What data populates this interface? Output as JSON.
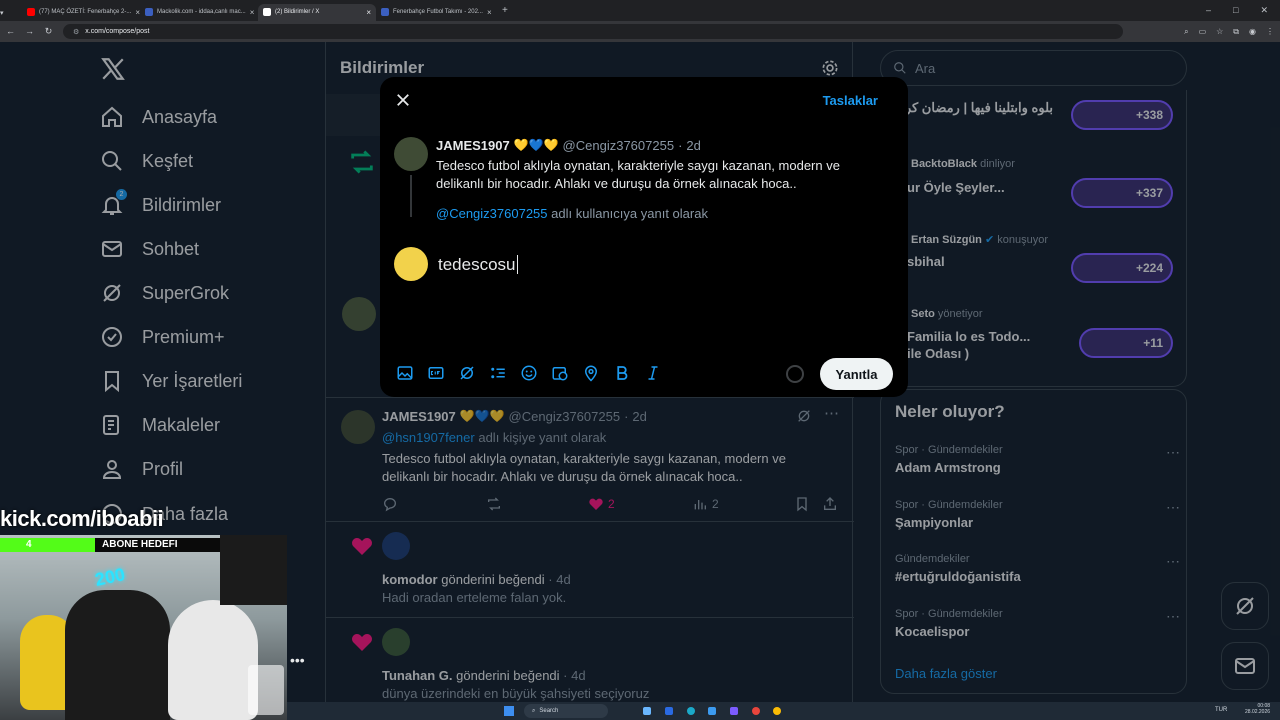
{
  "browser": {
    "tabs": [
      {
        "label": "(77) MAÇ ÖZETİ: Fenerbahçe 2-...",
        "color": "#ff0000"
      },
      {
        "label": "Mackolik.com - iddaa,canlı mac...",
        "color": "#3b5fc0"
      },
      {
        "label": "(2) Bildirimler / X",
        "color": "#ffffff"
      },
      {
        "label": "Fenerbahçe Futbol Takımı - 202...",
        "color": "#3b5fc0"
      }
    ],
    "url": "x.com/compose/post"
  },
  "sidebar": {
    "items": [
      {
        "label": "Anasayfa",
        "icon": "home-icon"
      },
      {
        "label": "Keşfet",
        "icon": "search-icon"
      },
      {
        "label": "Bildirimler",
        "icon": "bell-icon",
        "badge": "2"
      },
      {
        "label": "Sohbet",
        "icon": "mail-icon"
      },
      {
        "label": "SuperGrok",
        "icon": "grok-icon"
      },
      {
        "label": "Premium+",
        "icon": "verified-icon"
      },
      {
        "label": "Yer İşaretleri",
        "icon": "bookmark-icon"
      },
      {
        "label": "Makaleler",
        "icon": "article-icon"
      },
      {
        "label": "Profil",
        "icon": "person-icon"
      },
      {
        "label": "Daha fazla",
        "icon": "more-icon"
      }
    ]
  },
  "main": {
    "title": "Bildirimler",
    "post": {
      "name": "JAMES1907",
      "handle": "@Cengiz37607255",
      "time": "2d",
      "reply_to": "@hsn1907fener",
      "reply_suffix": "adlı kişiye yanıt olarak",
      "text": "Tedesco futbol aklıyla oynatan, karakteriyle saygı kazanan, modern ve delikanlı bir hocadır. Ahlakı ve duruşu da örnek alınacak hoca..",
      "likes": "2",
      "views": "2"
    },
    "likes": [
      {
        "user": "komodor",
        "action": "gönderini beğendi",
        "time": "4d",
        "text": "Hadi oradan erteleme falan yok."
      },
      {
        "user": "Tunahan G.",
        "action": "gönderini beğendi",
        "time": "4d",
        "text": "dünya üzerindeki en büyük şahsiyeti seçiyoruz"
      }
    ]
  },
  "right": {
    "search_placeholder": "Ara",
    "spaces": [
      {
        "host": "",
        "verb": "",
        "title": "بلوه وابتلينا فيها | رمضان كريم",
        "count": "+338"
      },
      {
        "host": "BacktoBlack",
        "verb": "dinliyor",
        "title": "ur Öyle Şeyler...",
        "count": "+337"
      },
      {
        "host": "Ertan Süzgün",
        "verb": "konuşuyor",
        "title": "sbihal",
        "count": "+224"
      },
      {
        "host": "Seto",
        "verb": "yönetiyor",
        "title": "Familia lo es Todo...",
        "title2": "ile Odası )",
        "count": "+11"
      }
    ],
    "trends_title": "Neler oluyor?",
    "trends": [
      {
        "cat": "Spor · Gündemdekiler",
        "name": "Adam Armstrong"
      },
      {
        "cat": "Spor · Gündemdekiler",
        "name": "Şampiyonlar"
      },
      {
        "cat": "Gündemdekiler",
        "name": "#ertuğruldoğanistifa"
      },
      {
        "cat": "Spor · Gündemdekiler",
        "name": "Kocaelispor"
      }
    ],
    "show_more": "Daha fazla göster"
  },
  "modal": {
    "drafts": "Taslaklar",
    "quoted": {
      "name": "JAMES1907",
      "handle": "@Cengiz37607255",
      "time": "2d",
      "text": "Tedesco futbol aklıyla oynatan, karakteriyle saygı kazanan, modern ve delikanlı bir hocadır. Ahlakı ve duruşu da örnek alınacak hoca..",
      "reply_handle": "@Cengiz37607255",
      "reply_suffix": "adlı kullanıcıya yanıt olarak"
    },
    "input_value": "tedescosu",
    "reply_button": "Yanıtla"
  },
  "overlay": {
    "stream_url": "kick.com/iboabii",
    "goal_left": "4",
    "goal_label": "ABONE HEDEFI",
    "goal_right": "10",
    "sticker_text": "200"
  },
  "taskbar": {
    "search": "Search",
    "lang": "TUR",
    "time": "00:08",
    "date": "28.02.2026"
  },
  "colors": {
    "accent": "#1d9bf0",
    "like": "#f91880",
    "bg": "#15202b"
  }
}
